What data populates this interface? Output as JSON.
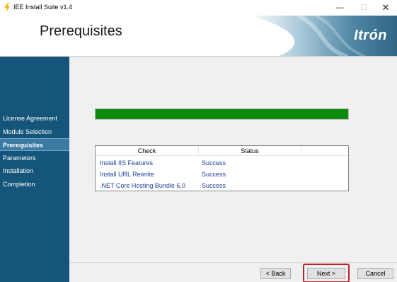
{
  "window": {
    "title": "IEE Install Suite v1.4",
    "minimize_glyph": "—",
    "maximize_glyph": "☐",
    "close_glyph": "✕"
  },
  "header": {
    "title": "Prerequisites",
    "brand": "Itrón"
  },
  "sidebar": {
    "items": [
      {
        "label": "License Agreement",
        "active": false
      },
      {
        "label": "Module Selection",
        "active": false
      },
      {
        "label": "Prerequisites",
        "active": true
      },
      {
        "label": "Parameters",
        "active": false
      },
      {
        "label": "Installation",
        "active": false
      },
      {
        "label": "Completion",
        "active": false
      }
    ]
  },
  "main": {
    "progress": 1.0,
    "table": {
      "columns": [
        "Check",
        "Status",
        ""
      ],
      "rows": [
        {
          "check": "Install IIS Features",
          "status": "Success"
        },
        {
          "check": "Install URL Rewrite",
          "status": "Success"
        },
        {
          "check": ".NET Core Hosting Bundle 6.0",
          "status": "Success"
        }
      ]
    }
  },
  "footer": {
    "back_label": "< Back",
    "next_label": "Next >",
    "cancel_label": "Cancel"
  },
  "colors": {
    "sidebar_bg": "#15557a",
    "sidebar_active": "#3b7aa3",
    "progress_fill": "#0b8a0b",
    "link_text": "#1f3f9c",
    "highlight": "#c0202a"
  },
  "icons": {
    "app": "installer-lightning-icon"
  }
}
